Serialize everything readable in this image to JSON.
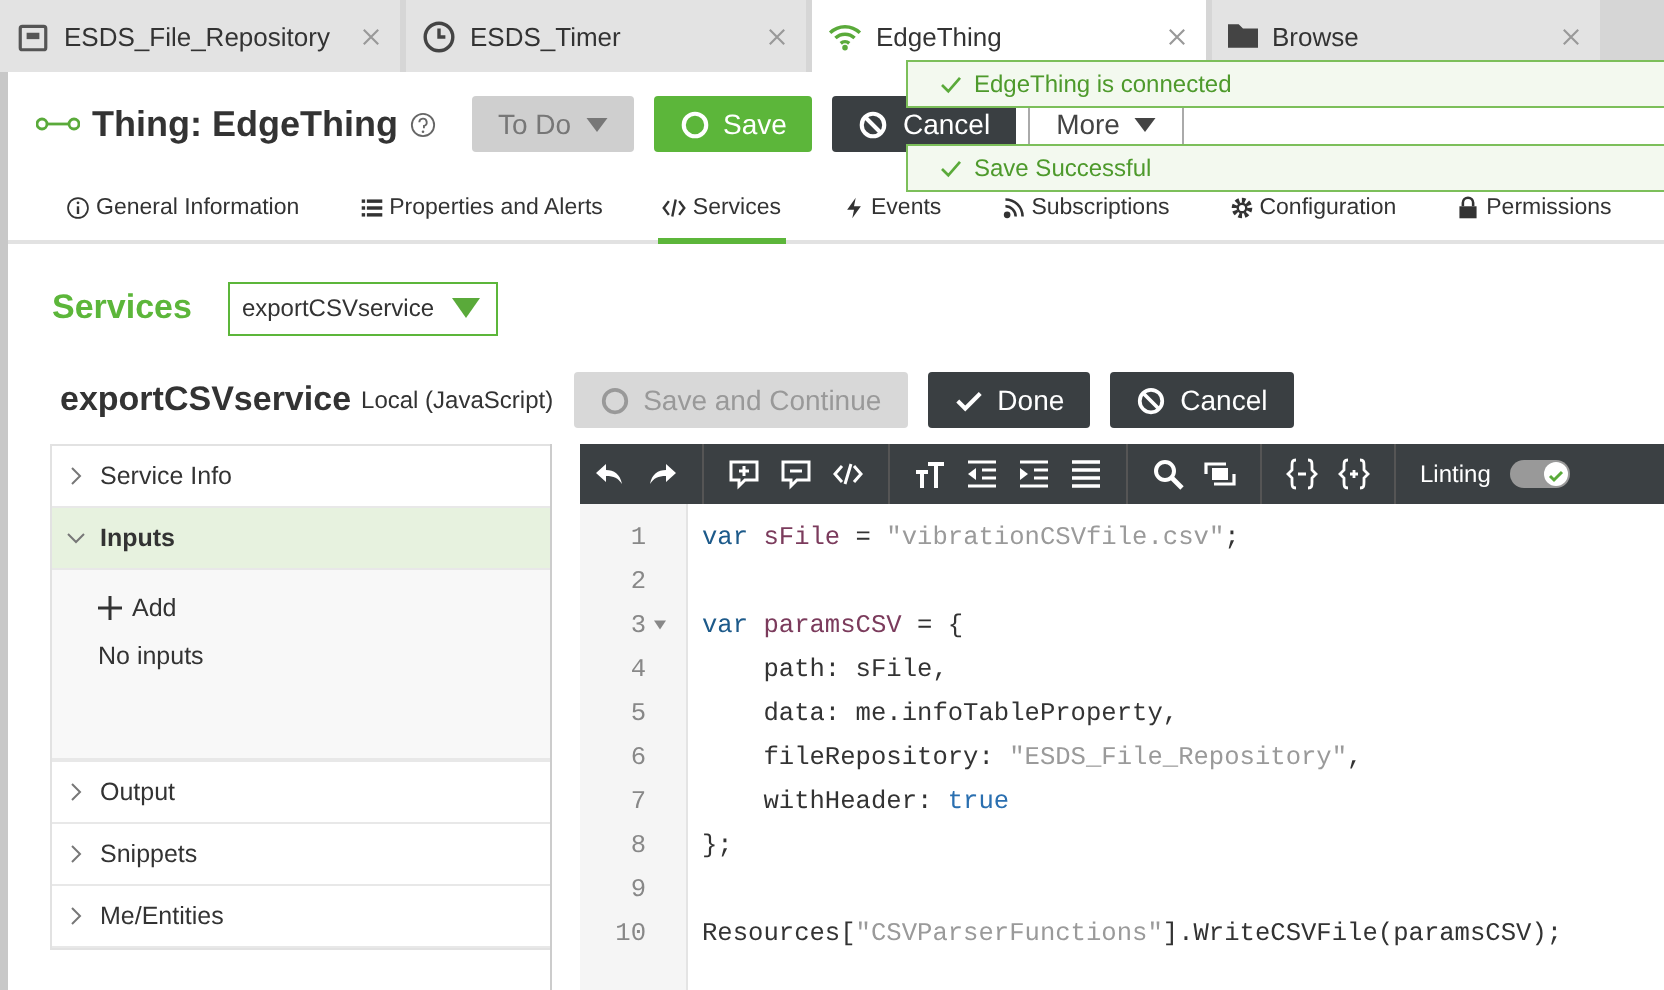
{
  "tabs": [
    {
      "label": "ESDS_File_Repository",
      "kind": "repository",
      "selected": false
    },
    {
      "label": "ESDS_Timer",
      "kind": "timer",
      "selected": false
    },
    {
      "label": "EdgeThing",
      "kind": "thing",
      "selected": true
    },
    {
      "label": "Browse",
      "kind": "folder",
      "selected": false
    }
  ],
  "header": {
    "title": "Thing: EdgeThing",
    "buttons": [
      {
        "label": "To Do",
        "kind": "dropdown"
      },
      {
        "label": "Save",
        "kind": "save"
      },
      {
        "label": "Cancel",
        "kind": "cancel"
      },
      {
        "label": "More",
        "kind": "menu"
      }
    ]
  },
  "nav": [
    {
      "label": "General Information",
      "selected": false
    },
    {
      "label": "Properties and Alerts",
      "selected": false
    },
    {
      "label": "Services",
      "selected": true
    },
    {
      "label": "Events",
      "selected": false
    },
    {
      "label": "Subscriptions",
      "selected": false
    },
    {
      "label": "Configuration",
      "selected": false
    },
    {
      "label": "Permissions",
      "selected": false
    }
  ],
  "toasts": [
    {
      "message": "EdgeThing is connected"
    },
    {
      "message": "Save Successful"
    }
  ],
  "services": {
    "heading": "Services",
    "selected_service": "exportCSVservice"
  },
  "service": {
    "name": "exportCSVservice",
    "scope": "Local (JavaScript)",
    "buttons": [
      {
        "label": "Save and Continue",
        "kind": "save",
        "disabled": true
      },
      {
        "label": "Done",
        "kind": "done",
        "disabled": false
      },
      {
        "label": "Cancel",
        "kind": "cancel",
        "disabled": false
      }
    ]
  },
  "sections": [
    {
      "label": "Service Info",
      "expanded": false
    },
    {
      "label": "Inputs",
      "expanded": true,
      "add_label": "Add",
      "empty_text": "No inputs"
    },
    {
      "label": "Output",
      "expanded": false
    },
    {
      "label": "Snippets",
      "expanded": false
    },
    {
      "label": "Me/Entities",
      "expanded": false
    }
  ],
  "editor": {
    "linting": {
      "label": "Linting",
      "on": true
    },
    "lines": [
      {
        "number": "1",
        "foldable": false,
        "tokens": [
          {
            "kind": "keyword",
            "text": "var "
          },
          {
            "kind": "variable",
            "text": "sFile"
          },
          {
            "kind": "plain",
            "text": " = "
          },
          {
            "kind": "string",
            "text": "\"vibrationCSVfile.csv\""
          },
          {
            "kind": "plain",
            "text": ";"
          }
        ]
      },
      {
        "number": "2",
        "foldable": false
      },
      {
        "number": "3",
        "foldable": true,
        "tokens": [
          {
            "kind": "keyword",
            "text": "var "
          },
          {
            "kind": "variable",
            "text": "paramsCSV"
          },
          {
            "kind": "plain",
            "text": " = {"
          }
        ]
      },
      {
        "number": "4",
        "foldable": false,
        "tokens": [
          {
            "kind": "plain",
            "text": "    path: sFile,"
          }
        ]
      },
      {
        "number": "5",
        "foldable": false,
        "tokens": [
          {
            "kind": "plain",
            "text": "    data: me.infoTableProperty,"
          }
        ]
      },
      {
        "number": "6",
        "foldable": false,
        "tokens": [
          {
            "kind": "plain",
            "text": "    fileRepository: "
          },
          {
            "kind": "string",
            "text": "\"ESDS_File_Repository\""
          },
          {
            "kind": "plain",
            "text": ","
          }
        ]
      },
      {
        "number": "7",
        "foldable": false,
        "tokens": [
          {
            "kind": "plain",
            "text": "    withHeader: "
          },
          {
            "kind": "atom",
            "text": "true"
          }
        ]
      },
      {
        "number": "8",
        "foldable": false,
        "tokens": [
          {
            "kind": "plain",
            "text": "};"
          }
        ]
      },
      {
        "number": "9",
        "foldable": false
      },
      {
        "number": "10",
        "foldable": false,
        "tokens": [
          {
            "kind": "plain",
            "text": "Resources["
          },
          {
            "kind": "string",
            "text": "\"CSVParserFunctions\""
          },
          {
            "kind": "plain",
            "text": "].WriteCSVFile(paramsCSV);"
          }
        ]
      }
    ]
  }
}
